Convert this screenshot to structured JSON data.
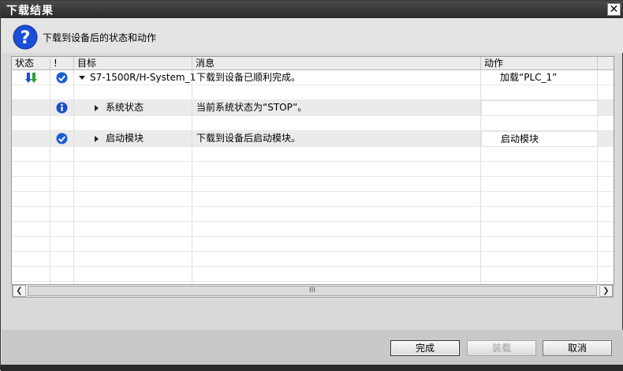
{
  "window": {
    "title": "下载结果"
  },
  "header": {
    "text": "下载到设备后的状态和动作",
    "icon": "question-icon"
  },
  "grid": {
    "columns": [
      "状态",
      "!",
      "目标",
      "消息",
      "动作"
    ],
    "rows": [
      {
        "status_icon": "download-arrow-icon",
        "severity_icon": "check-circle-icon",
        "expand": "down",
        "target": "S7-1500R/H-System_1",
        "message": "下载到设备已顺利完成。",
        "action": "加载“PLC_1”"
      },
      {
        "status_icon": "",
        "severity_icon": "",
        "expand": "",
        "target": "",
        "message": "",
        "action": ""
      },
      {
        "status_icon": "",
        "severity_icon": "info-circle-icon",
        "expand": "right",
        "target": "系统状态",
        "message": "当前系统状态为“STOP”。",
        "action": ""
      },
      {
        "status_icon": "",
        "severity_icon": "",
        "expand": "",
        "target": "",
        "message": "",
        "action": ""
      },
      {
        "status_icon": "",
        "severity_icon": "check-circle-icon",
        "expand": "right",
        "target": "启动模块",
        "message": "下载到设备后启动模块。",
        "action": "启动模块"
      }
    ]
  },
  "scrollbar": {
    "thumb_grip": "III"
  },
  "buttons": {
    "finish": "完成",
    "load": "装载",
    "cancel": "取消"
  },
  "colors": {
    "check_blue": "#1a5fd0",
    "info_blue": "#1a4fc8",
    "download_green": "#2e9e3a",
    "question_blue": "#1b4ed8"
  }
}
